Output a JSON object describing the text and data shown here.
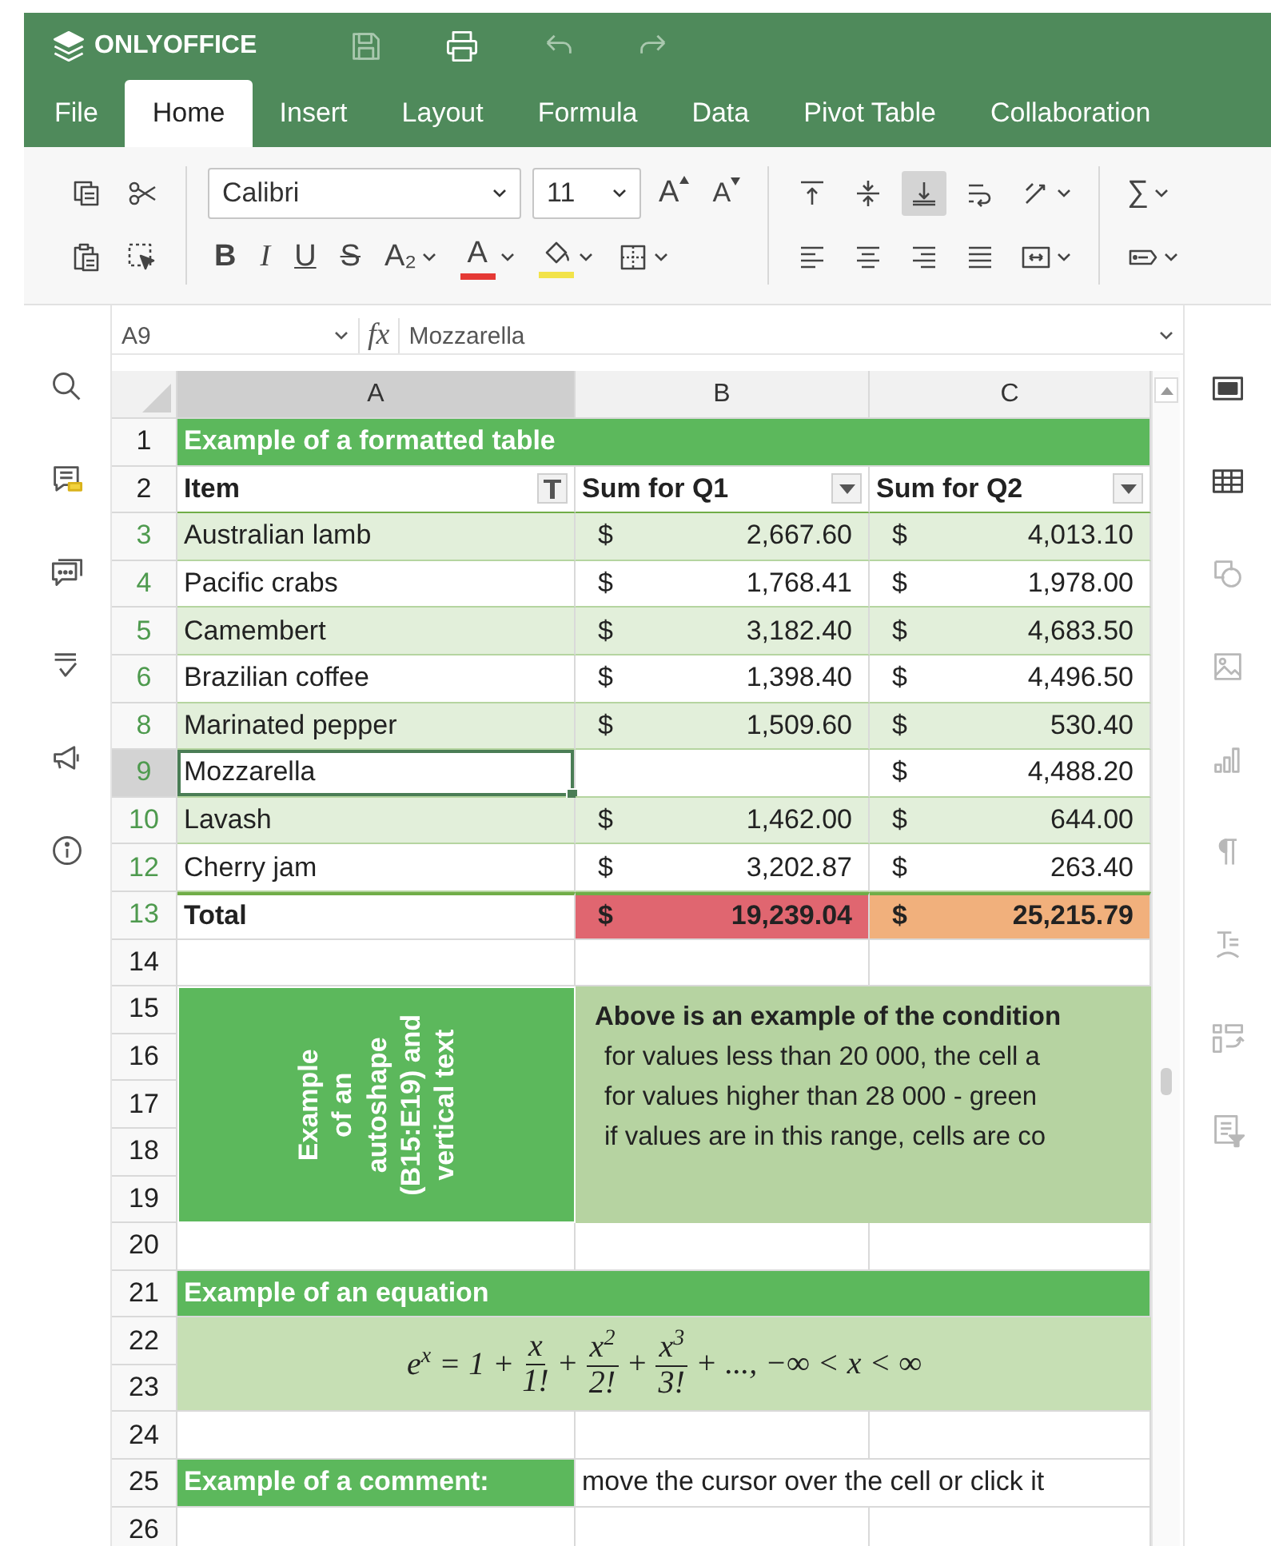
{
  "header": {
    "app_name": "ONLYOFFICE",
    "actions": [
      {
        "kind": "save",
        "disabled": true
      },
      {
        "kind": "print",
        "disabled": false
      },
      {
        "kind": "undo",
        "disabled": true
      },
      {
        "kind": "redo",
        "disabled": true
      }
    ]
  },
  "tabs": [
    {
      "label": "File",
      "selected": false
    },
    {
      "label": "Home",
      "selected": true
    },
    {
      "label": "Insert",
      "selected": false
    },
    {
      "label": "Layout",
      "selected": false
    },
    {
      "label": "Formula",
      "selected": false
    },
    {
      "label": "Data",
      "selected": false
    },
    {
      "label": "Pivot Table",
      "selected": false
    },
    {
      "label": "Collaboration",
      "selected": false
    }
  ],
  "toolbar": {
    "groups": [
      {
        "top": [
          {
            "kind": "copy"
          },
          {
            "kind": "cut"
          }
        ],
        "bottom": [
          {
            "kind": "paste"
          },
          {
            "kind": "select"
          }
        ]
      },
      {
        "top": [
          {
            "kind": "font",
            "value": "Calibri"
          },
          {
            "kind": "size",
            "value": "11"
          },
          {
            "kind": "grow",
            "glyph": "A"
          },
          {
            "kind": "shrink",
            "glyph": "A"
          }
        ],
        "bottom": [
          {
            "kind": "bold",
            "glyph": "B"
          },
          {
            "kind": "italic",
            "glyph": "I"
          },
          {
            "kind": "underline",
            "glyph": "U"
          },
          {
            "kind": "strike",
            "glyph": "S"
          },
          {
            "kind": "subscript",
            "glyph": "A₂",
            "dropdown": true
          },
          {
            "kind": "font-color",
            "glyph": "A",
            "color": "#e53935",
            "dropdown": true
          },
          {
            "kind": "fill",
            "color": "#f2e34a",
            "dropdown": true
          },
          {
            "kind": "borders",
            "dropdown": true
          }
        ]
      },
      {
        "top": [
          {
            "kind": "valign-top",
            "selected": false
          },
          {
            "kind": "valign-middle",
            "selected": false
          },
          {
            "kind": "valign-bottom",
            "selected": true
          },
          {
            "kind": "wrap"
          },
          {
            "kind": "orientation",
            "dropdown": true
          }
        ],
        "bottom": [
          {
            "kind": "align-left"
          },
          {
            "kind": "align-center"
          },
          {
            "kind": "align-right"
          },
          {
            "kind": "align-justify"
          },
          {
            "kind": "merge",
            "dropdown": true
          }
        ]
      },
      {
        "top": [
          {
            "kind": "sum",
            "glyph": "∑",
            "dropdown": true
          }
        ],
        "bottom": [
          {
            "kind": "named-range",
            "dropdown": true
          }
        ]
      }
    ]
  },
  "formula_bar": {
    "cell": "A9",
    "fx": "fx",
    "value": "Mozzarella"
  },
  "left_sidebar": [
    {
      "kind": "search"
    },
    {
      "kind": "comments"
    },
    {
      "kind": "chat"
    },
    {
      "kind": "spellcheck"
    },
    {
      "kind": "feedback"
    },
    {
      "kind": "about"
    }
  ],
  "right_sidebar": [
    {
      "kind": "cell-settings",
      "disabled": false
    },
    {
      "kind": "table",
      "disabled": false
    },
    {
      "kind": "shape",
      "disabled": true
    },
    {
      "kind": "image",
      "disabled": true
    },
    {
      "kind": "chart",
      "disabled": true
    },
    {
      "kind": "paragraph",
      "disabled": true
    },
    {
      "kind": "text-art",
      "disabled": true
    },
    {
      "kind": "pivot",
      "disabled": true
    },
    {
      "kind": "slicer",
      "disabled": true
    }
  ],
  "sheet": {
    "columns": [
      {
        "label": "A",
        "selected": true
      },
      {
        "label": "B",
        "selected": false
      },
      {
        "label": "C",
        "selected": false
      }
    ],
    "rows": [
      {
        "number": "1",
        "kind": "title",
        "filtered": false,
        "selected": false,
        "text": "Example of a formatted table"
      },
      {
        "number": "2",
        "kind": "header",
        "filtered": false,
        "selected": false,
        "cells": [
          {
            "text": "Item",
            "filter_applied": true
          },
          {
            "text": "Sum for Q1",
            "filter_applied": false
          },
          {
            "text": "Sum for Q2",
            "filter_applied": false
          }
        ]
      },
      {
        "number": "3",
        "kind": "data",
        "filtered": true,
        "selected": false,
        "banded": true,
        "item": "Australian lamb",
        "q1": {
          "currency": "$",
          "amount": "2,667.60"
        },
        "q2": {
          "currency": "$",
          "amount": "4,013.10"
        }
      },
      {
        "number": "4",
        "kind": "data",
        "filtered": true,
        "selected": false,
        "banded": false,
        "item": "Pacific crabs",
        "q1": {
          "currency": "$",
          "amount": "1,768.41"
        },
        "q2": {
          "currency": "$",
          "amount": "1,978.00"
        }
      },
      {
        "number": "5",
        "kind": "data",
        "filtered": true,
        "selected": false,
        "banded": true,
        "item": "Camembert",
        "q1": {
          "currency": "$",
          "amount": "3,182.40"
        },
        "q2": {
          "currency": "$",
          "amount": "4,683.50"
        }
      },
      {
        "number": "6",
        "kind": "data",
        "filtered": true,
        "selected": false,
        "banded": false,
        "item": "Brazilian coffee",
        "q1": {
          "currency": "$",
          "amount": "1,398.40"
        },
        "q2": {
          "currency": "$",
          "amount": "4,496.50"
        }
      },
      {
        "number": "8",
        "kind": "data",
        "filtered": true,
        "selected": false,
        "banded": true,
        "item": "Marinated pepper",
        "q1": {
          "currency": "$",
          "amount": "1,509.60"
        },
        "q2": {
          "currency": "$",
          "amount": "530.40"
        }
      },
      {
        "number": "9",
        "kind": "data",
        "filtered": true,
        "selected": true,
        "banded": false,
        "item": "Mozzarella",
        "q2": {
          "currency": "$",
          "amount": "4,488.20"
        }
      },
      {
        "number": "10",
        "kind": "data",
        "filtered": true,
        "selected": false,
        "banded": true,
        "item": "Lavash",
        "q1": {
          "currency": "$",
          "amount": "1,462.00"
        },
        "q2": {
          "currency": "$",
          "amount": "644.00"
        }
      },
      {
        "number": "12",
        "kind": "data",
        "filtered": true,
        "selected": false,
        "banded": false,
        "item": "Cherry jam",
        "q1": {
          "currency": "$",
          "amount": "3,202.87"
        },
        "q2": {
          "currency": "$",
          "amount": "263.40"
        }
      },
      {
        "number": "13",
        "kind": "total",
        "filtered": true,
        "selected": false,
        "label": "Total",
        "q1": {
          "currency": "$",
          "amount": "19,239.04",
          "color": "#e06670"
        },
        "q2": {
          "currency": "$",
          "amount": "25,215.79",
          "color": "#f1b07c"
        }
      },
      {
        "number": "14",
        "kind": "blank",
        "filtered": false,
        "selected": false
      },
      {
        "number": "15",
        "kind": "shape",
        "filtered": false,
        "selected": false
      },
      {
        "number": "16",
        "kind": "shape",
        "filtered": false,
        "selected": false
      },
      {
        "number": "17",
        "kind": "shape",
        "filtered": false,
        "selected": false
      },
      {
        "number": "18",
        "kind": "shape",
        "filtered": false,
        "selected": false
      },
      {
        "number": "19",
        "kind": "shape",
        "filtered": false,
        "selected": false
      },
      {
        "number": "20",
        "kind": "blank",
        "filtered": false,
        "selected": false
      },
      {
        "number": "21",
        "kind": "section",
        "filtered": false,
        "selected": false,
        "text": "Example of an equation"
      },
      {
        "number": "22",
        "kind": "equation",
        "filtered": false,
        "selected": false
      },
      {
        "number": "23",
        "kind": "equation",
        "filtered": false,
        "selected": false
      },
      {
        "number": "24",
        "kind": "blank",
        "filtered": false,
        "selected": false
      },
      {
        "number": "25",
        "kind": "comment",
        "filtered": false,
        "selected": false,
        "label": "Example of a comment:",
        "note": "move the cursor over the cell or click it"
      },
      {
        "number": "26",
        "kind": "blank",
        "filtered": false,
        "selected": false
      }
    ],
    "autoshape": {
      "lines": [
        "Example",
        "of an",
        "autoshape",
        "(B15:E19) and",
        "vertical text"
      ]
    },
    "text_box": {
      "lines": [
        {
          "text": "Above is an example of the condition",
          "bold": true
        },
        {
          "text": "for values less than 20 000, the cell a",
          "bold": false
        },
        {
          "text": "for values higher than 28 000 - green",
          "bold": false
        },
        {
          "text": "if values are in this range, cells are co",
          "bold": false
        }
      ]
    },
    "equation": {
      "parts": [
        {
          "kind": "text",
          "text": "e$^{x}$ = 1 +"
        },
        {
          "kind": "frac",
          "num": "x",
          "den": "1!"
        },
        {
          "kind": "text",
          "text": "+"
        },
        {
          "kind": "frac",
          "num": "x$^{2}$",
          "den": "2!"
        },
        {
          "kind": "text",
          "text": "+"
        },
        {
          "kind": "frac",
          "num": "x$^{3}$",
          "den": "3!"
        },
        {
          "kind": "text",
          "text": "+ ..., −∞ < x < ∞"
        }
      ]
    }
  }
}
